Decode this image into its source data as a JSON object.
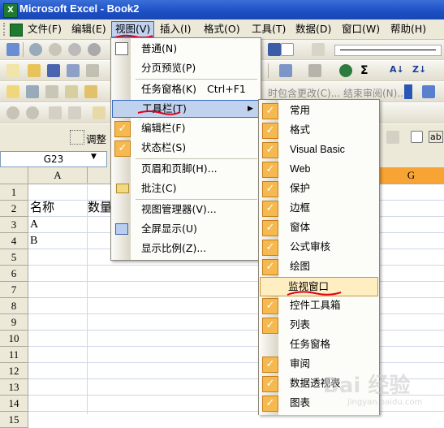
{
  "window": {
    "title": "Microsoft Excel - Book2",
    "app_icon": "X"
  },
  "menubar": {
    "items": [
      {
        "label": "文件(F)"
      },
      {
        "label": "编辑(E)"
      },
      {
        "label": "视图(V)"
      },
      {
        "label": "插入(I)"
      },
      {
        "label": "格式(O)"
      },
      {
        "label": "工具(T)"
      },
      {
        "label": "数据(D)"
      },
      {
        "label": "窗口(W)"
      },
      {
        "label": "帮助(H)"
      }
    ]
  },
  "toolbar_fragments": {
    "review_text": "时包含更改(C)...  结束审阅(N)...",
    "adjust_label": "调整",
    "ab_label": "ab"
  },
  "namebox": {
    "value": "G23"
  },
  "columns": [
    "A",
    "G"
  ],
  "rows": [
    "1",
    "2",
    "3",
    "4",
    "5",
    "6",
    "7",
    "8",
    "9",
    "10",
    "11",
    "12",
    "13",
    "14",
    "15"
  ],
  "cells": {
    "A2": "名称",
    "B2": "数量",
    "A3": "A",
    "A4": "B"
  },
  "view_menu": {
    "items": [
      {
        "label": "普通(N)",
        "shortcut": ""
      },
      {
        "label": "分页预览(P)",
        "shortcut": ""
      },
      {
        "label": "任务窗格(K)",
        "shortcut": "Ctrl+F1"
      },
      {
        "label": "工具栏(T)",
        "shortcut": ""
      },
      {
        "label": "编辑栏(F)",
        "shortcut": ""
      },
      {
        "label": "状态栏(S)",
        "shortcut": ""
      },
      {
        "label": "页眉和页脚(H)...",
        "shortcut": ""
      },
      {
        "label": "批注(C)",
        "shortcut": ""
      },
      {
        "label": "视图管理器(V)...",
        "shortcut": ""
      },
      {
        "label": "全屏显示(U)",
        "shortcut": ""
      },
      {
        "label": "显示比例(Z)...",
        "shortcut": ""
      }
    ]
  },
  "toolbars_submenu": {
    "items": [
      {
        "label": "常用",
        "checked": true
      },
      {
        "label": "格式",
        "checked": true
      },
      {
        "label": "Visual Basic",
        "checked": true
      },
      {
        "label": "Web",
        "checked": true
      },
      {
        "label": "保护",
        "checked": true
      },
      {
        "label": "边框",
        "checked": true
      },
      {
        "label": "窗体",
        "checked": true
      },
      {
        "label": "公式审核",
        "checked": true
      },
      {
        "label": "绘图",
        "checked": true
      },
      {
        "label": "监视窗口",
        "checked": false
      },
      {
        "label": "控件工具箱",
        "checked": true
      },
      {
        "label": "列表",
        "checked": true
      },
      {
        "label": "任务窗格",
        "checked": false
      },
      {
        "label": "审阅",
        "checked": true
      },
      {
        "label": "数据透视表",
        "checked": true
      },
      {
        "label": "图表",
        "checked": true
      }
    ]
  },
  "watermark": {
    "text": "Bai 经验",
    "sub": "jingyan.baidu.com"
  },
  "colors": {
    "menu_highlight": "#c1d2ee",
    "check_bg": "#f5b94f",
    "submenu_highlight": "#ffeec2",
    "annotation_red": "#e0001b"
  }
}
